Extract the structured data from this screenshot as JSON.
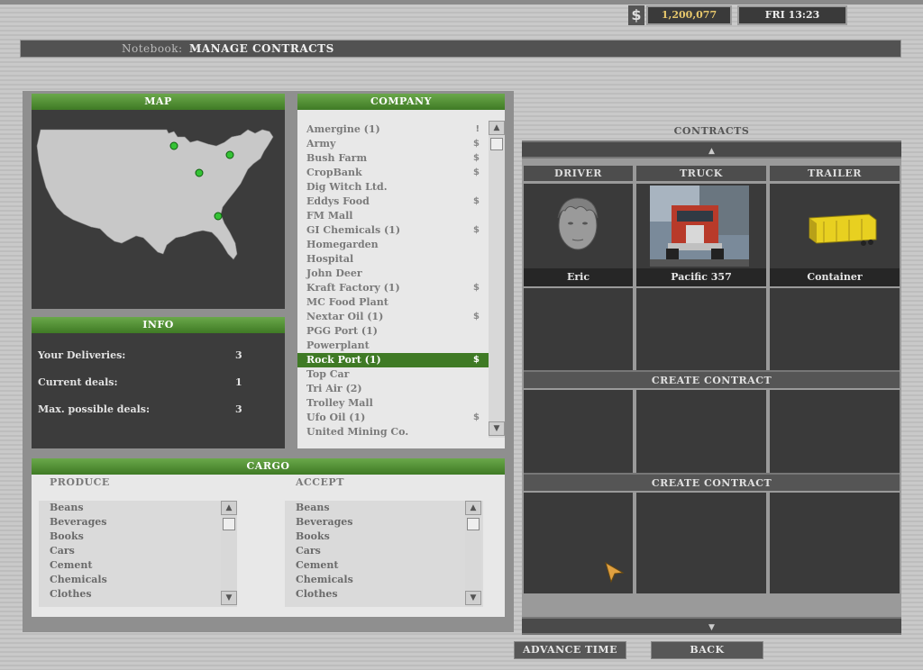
{
  "topbar": {
    "currency_symbol": "$",
    "money": "1,200,077",
    "clock": "FRI 13:23"
  },
  "notebook": {
    "label": "Notebook:",
    "title": "MANAGE CONTRACTS"
  },
  "map": {
    "title": "MAP"
  },
  "info": {
    "title": "INFO",
    "rows": [
      {
        "label": "Your Deliveries:",
        "value": "3"
      },
      {
        "label": "Current deals:",
        "value": "1"
      },
      {
        "label": "Max. possible deals:",
        "value": "3"
      }
    ]
  },
  "company": {
    "title": "COMPANY",
    "items": [
      {
        "name": "Amergine (1)",
        "flag": "!"
      },
      {
        "name": "Army",
        "flag": "$"
      },
      {
        "name": "Bush Farm",
        "flag": "$"
      },
      {
        "name": "CropBank",
        "flag": "$"
      },
      {
        "name": "Dig Witch Ltd.",
        "flag": ""
      },
      {
        "name": "Eddys Food",
        "flag": "$"
      },
      {
        "name": "FM Mall",
        "flag": ""
      },
      {
        "name": "GI Chemicals (1)",
        "flag": "$"
      },
      {
        "name": "Homegarden",
        "flag": ""
      },
      {
        "name": "Hospital",
        "flag": ""
      },
      {
        "name": "John Deer",
        "flag": ""
      },
      {
        "name": "Kraft Factory (1)",
        "flag": "$"
      },
      {
        "name": "MC Food Plant",
        "flag": ""
      },
      {
        "name": "Nextar Oil (1)",
        "flag": "$"
      },
      {
        "name": "PGG Port (1)",
        "flag": ""
      },
      {
        "name": "Powerplant",
        "flag": ""
      },
      {
        "name": "Rock Port (1)",
        "flag": "$"
      },
      {
        "name": "Top Car",
        "flag": ""
      },
      {
        "name": "Tri Air (2)",
        "flag": ""
      },
      {
        "name": "Trolley Mall",
        "flag": ""
      },
      {
        "name": "Ufo Oil (1)",
        "flag": "$"
      },
      {
        "name": "United Mining Co.",
        "flag": ""
      }
    ],
    "selected_index": 16
  },
  "cargo": {
    "title": "CARGO",
    "produce_label": "PRODUCE",
    "accept_label": "ACCEPT",
    "produce": [
      "Beans",
      "Beverages",
      "Books",
      "Cars",
      "Cement",
      "Chemicals",
      "Clothes"
    ],
    "accept": [
      "Beans",
      "Beverages",
      "Books",
      "Cars",
      "Cement",
      "Chemicals",
      "Clothes"
    ]
  },
  "contracts": {
    "title": "CONTRACTS",
    "columns": {
      "driver": "DRIVER",
      "truck": "TRUCK",
      "trailer": "TRAILER"
    },
    "row1": {
      "driver": "Eric",
      "truck": "Pacific 357",
      "trailer": "Container"
    },
    "create_label": "CREATE CONTRACT"
  },
  "buttons": {
    "advance_time": "ADVANCE TIME",
    "back": "BACK"
  },
  "icons": {
    "scroll_up": "▲",
    "scroll_down": "▼"
  },
  "colors": {
    "accent_green": "#3f7a25",
    "money_text": "#e8c86c"
  }
}
